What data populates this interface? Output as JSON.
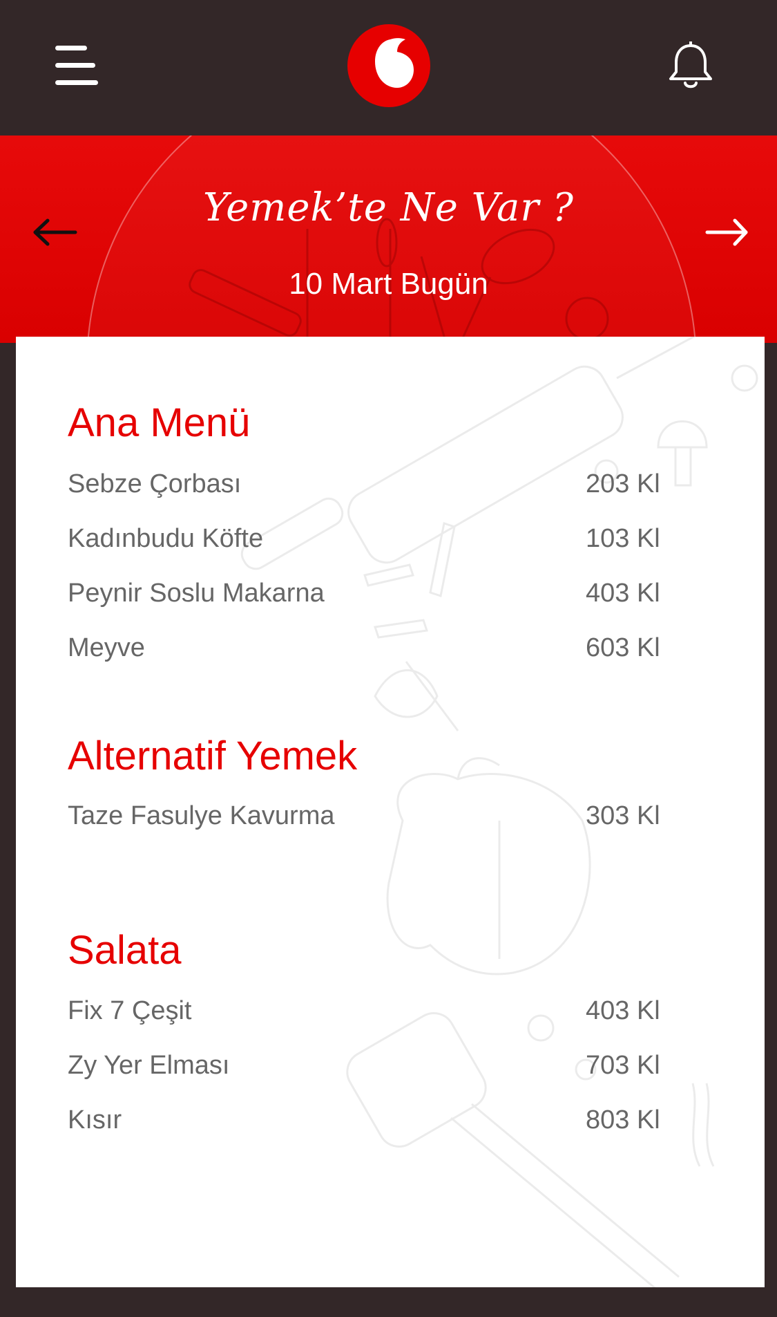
{
  "header": {
    "menu_icon": "hamburger-menu-icon",
    "logo_icon": "vodafone-logo-icon",
    "bell_icon": "bell-icon",
    "brand_color": "#e60000",
    "bar_color": "#332728"
  },
  "banner": {
    "title": "Yemek’te Ne Var ?",
    "date": "10 Mart Bugün",
    "prev_icon": "arrow-left-icon",
    "next_icon": "arrow-right-icon"
  },
  "menu": {
    "sections": [
      {
        "title": "Ana Menü",
        "items": [
          {
            "name": "Sebze Çorbası",
            "cal": "203 Kl"
          },
          {
            "name": "Kadınbudu Köfte",
            "cal": "103 Kl"
          },
          {
            "name": "Peynir Soslu Makarna",
            "cal": "403 Kl"
          },
          {
            "name": "Meyve",
            "cal": "603 Kl"
          }
        ]
      },
      {
        "title": "Alternatif Yemek",
        "items": [
          {
            "name": "Taze Fasulye Kavurma",
            "cal": "303 Kl"
          }
        ]
      },
      {
        "title": "Salata",
        "items": [
          {
            "name": "Fix 7 Çeşit",
            "cal": "403 Kl"
          },
          {
            "name": "Zy Yer Elması",
            "cal": "703 Kl"
          },
          {
            "name": "Kısır",
            "cal": "803 Kl"
          }
        ]
      }
    ]
  }
}
